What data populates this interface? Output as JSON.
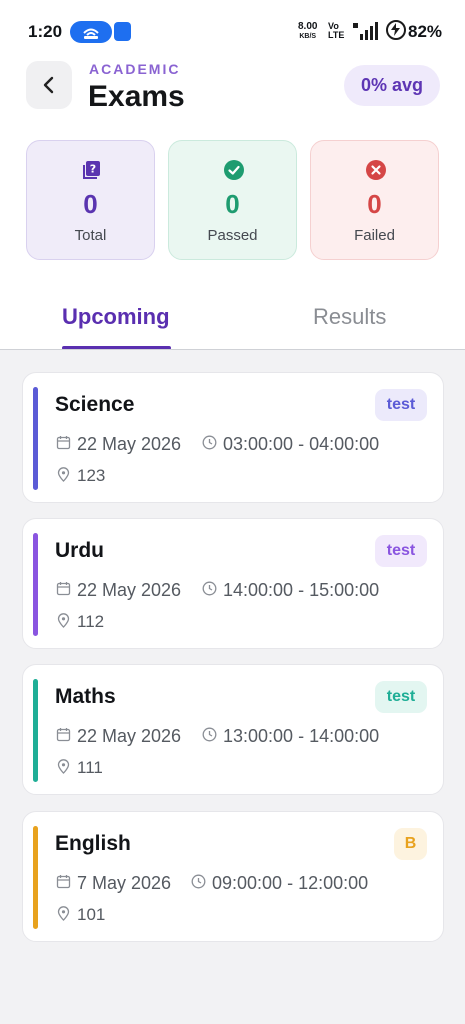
{
  "status_bar": {
    "time": "1:20",
    "net_speed_value": "8.00",
    "net_speed_unit": "KB/S",
    "volte_top": "Vo",
    "volte_bottom": "LTE",
    "battery": "82%"
  },
  "header": {
    "kicker": "ACADEMIC",
    "title": "Exams",
    "average": "0% avg"
  },
  "stats": [
    {
      "value": "0",
      "label": "Total"
    },
    {
      "value": "0",
      "label": "Passed"
    },
    {
      "value": "0",
      "label": "Failed"
    }
  ],
  "tabs": [
    {
      "label": "Upcoming",
      "active": true
    },
    {
      "label": "Results",
      "active": false
    }
  ],
  "exams": [
    {
      "subject": "Science",
      "badge": "test",
      "date": "22 May 2026",
      "time": "03:00:00 - 04:00:00",
      "room": "123",
      "accent": "#5b5bd6",
      "badge_bg": "#eceafb",
      "badge_fg": "#5b5bd6"
    },
    {
      "subject": "Urdu",
      "badge": "test",
      "date": "22 May 2026",
      "time": "14:00:00 - 15:00:00",
      "room": "112",
      "accent": "#8a55e0",
      "badge_bg": "#f1e9fc",
      "badge_fg": "#8a55e0"
    },
    {
      "subject": "Maths",
      "badge": "test",
      "date": "22 May 2026",
      "time": "13:00:00 - 14:00:00",
      "room": "111",
      "accent": "#1fae96",
      "badge_bg": "#e3f6f1",
      "badge_fg": "#1fae96"
    },
    {
      "subject": "English",
      "badge": "B",
      "date": "7 May 2026",
      "time": "09:00:00 - 12:00:00",
      "room": "101",
      "accent": "#e8a21e",
      "badge_bg": "#fdf3df",
      "badge_fg": "#e8a21e"
    }
  ]
}
